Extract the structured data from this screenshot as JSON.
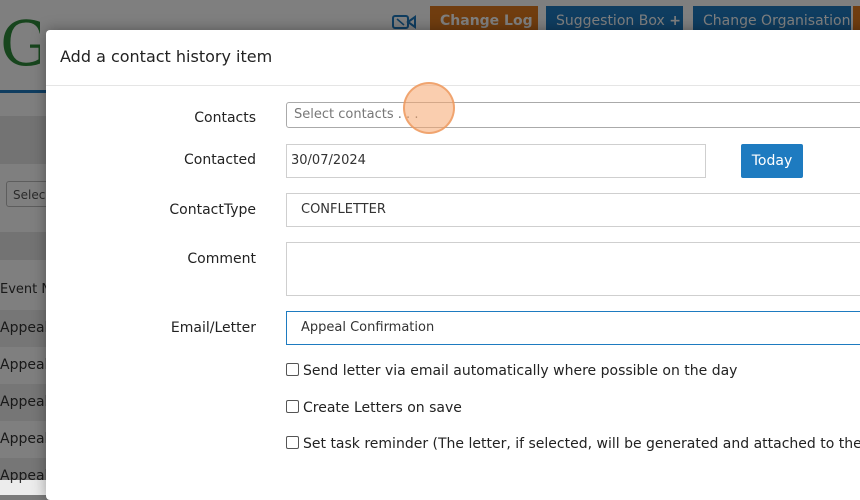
{
  "background": {
    "logo_letter": "G",
    "video_icon": "video-camera-icon",
    "header_buttons": {
      "change_log": "Change Log",
      "change_log_icon": "!",
      "suggestion_box": "Suggestion Box",
      "suggestion_box_icon": "+",
      "change_organisation": "Change Organisation"
    },
    "select_stub": "Selec",
    "table_header": "Event Na",
    "rows": [
      "Appeal",
      "Appeal",
      "Appeal",
      "Appeal",
      "Appeal"
    ]
  },
  "modal": {
    "title": "Add a contact history item",
    "contacts": {
      "label": "Contacts",
      "placeholder": "Select contacts . . ."
    },
    "contacted": {
      "label": "Contacted",
      "value": "30/07/2024",
      "today_label": "Today"
    },
    "contact_type": {
      "label": "ContactType",
      "value": "CONFLETTER"
    },
    "comment": {
      "label": "Comment",
      "value": ""
    },
    "email_letter": {
      "label": "Email/Letter",
      "value": "Appeal Confirmation"
    },
    "checkboxes": [
      {
        "label": "Send letter via email automatically where possible on the day",
        "checked": false
      },
      {
        "label": "Create Letters on save",
        "checked": false
      },
      {
        "label": "Set task reminder (The letter, if selected, will be generated and attached to the email remi",
        "checked": false
      }
    ]
  },
  "colors": {
    "primary_blue": "#1e7bc0",
    "orange": "#e07b1f",
    "logo_green": "#2e8b3a",
    "cursor_highlight": "#f6a66e"
  }
}
